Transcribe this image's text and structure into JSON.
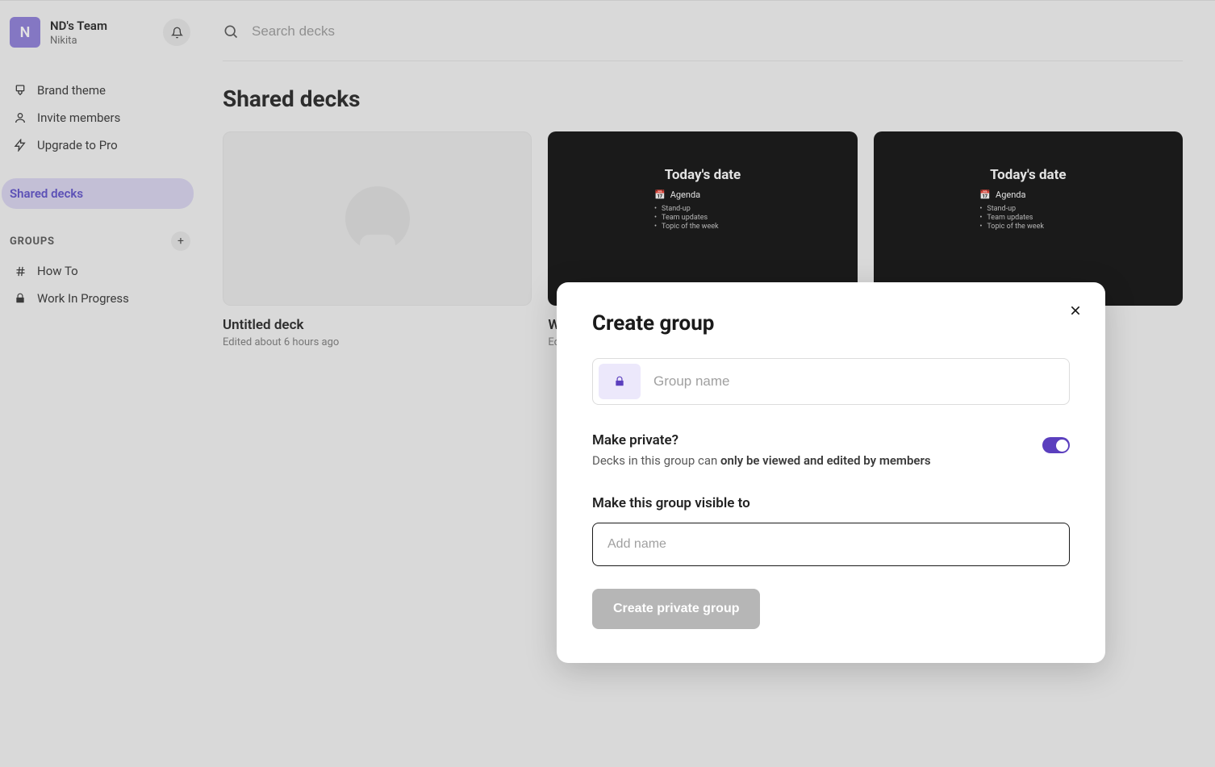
{
  "sidebar": {
    "avatar_initial": "N",
    "team_name": "ND's Team",
    "user_name": "Nikita",
    "items": [
      {
        "label": "Brand theme"
      },
      {
        "label": "Invite members"
      },
      {
        "label": "Upgrade to Pro"
      }
    ],
    "active_item": "Shared decks",
    "groups_label": "GROUPS",
    "groups": [
      {
        "label": "How To"
      },
      {
        "label": "Work In Progress"
      }
    ]
  },
  "search": {
    "placeholder": "Search decks"
  },
  "page": {
    "title": "Shared decks"
  },
  "decks": [
    {
      "title": "Untitled deck",
      "meta": "Edited about 6 hours ago",
      "variant": "empty"
    },
    {
      "title": "Weekly",
      "meta": "Edited abo",
      "variant": "dark",
      "heading": "Today's date",
      "sub": "Agenda",
      "bullets": [
        "Stand-up",
        "Team updates",
        "Topic of the week"
      ]
    },
    {
      "title": "",
      "meta": "",
      "variant": "dark",
      "heading": "Today's date",
      "sub": "Agenda",
      "bullets": [
        "Stand-up",
        "Team updates",
        "Topic of the week"
      ]
    }
  ],
  "modal": {
    "title": "Create group",
    "group_name_placeholder": "Group name",
    "private_question": "Make private?",
    "private_desc_prefix": "Decks in this group can ",
    "private_desc_bold": "only be viewed and edited by members",
    "visible_label": "Make this group visible to",
    "visible_placeholder": "Add name",
    "button_label": "Create private group"
  },
  "colors": {
    "accent": "#5b3fbe",
    "sidebar_active": "#d8d3f0"
  }
}
